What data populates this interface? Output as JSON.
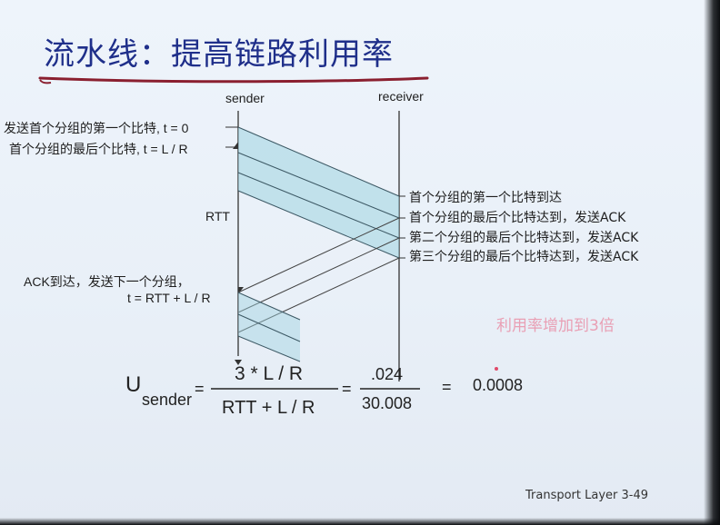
{
  "title": "流水线：提高链路利用率",
  "sender_label": "sender",
  "receiver_label": "receiver",
  "left_labels": {
    "first_bit_sent": "发送首个分组的第一个比特, t = 0",
    "last_bit_sent": "首个分组的最后个比特, t = L / R",
    "rtt": "RTT",
    "ack_arrives": "ACK到达，发送下一个分组，",
    "ack_time": "t = RTT + L / R"
  },
  "right_labels": [
    "首个分组的第一个比特到达",
    "首个分组的最后个比特达到，发送ACK",
    "第二个分组的最后个比特达到，发送ACK",
    "第三个分组的最后个比特达到，发送ACK"
  ],
  "note": "利用率增加到3倍",
  "formula": {
    "u": "U",
    "subscript": "sender",
    "num1": "3 * L / R",
    "den1": "RTT + L / R",
    "eq1": "=",
    "num2": ".024",
    "den2": "30.008",
    "eq2": "=",
    "result": "0.0008"
  },
  "footer": "Transport Layer   3-49",
  "colors": {
    "title": "#1f2f8a",
    "underline": "#8a1f2f",
    "packet_fill": "#9fd3e0",
    "note": "#e99fb4"
  }
}
